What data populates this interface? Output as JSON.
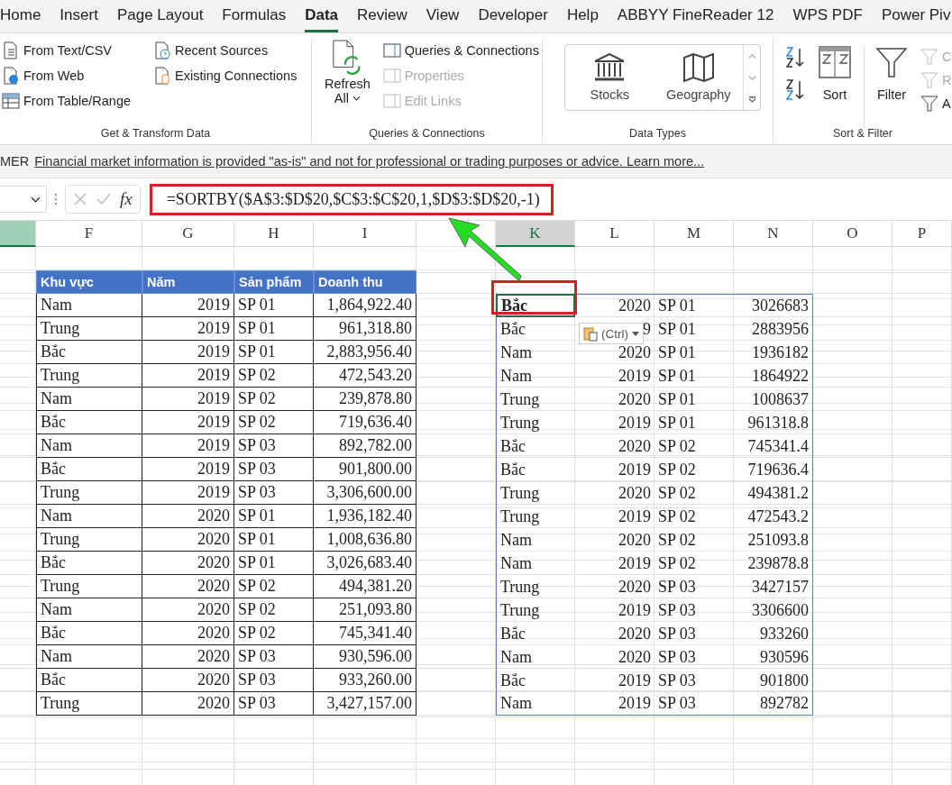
{
  "ribbon_tabs": [
    {
      "label": "Home",
      "selected": false
    },
    {
      "label": "Insert",
      "selected": false
    },
    {
      "label": "Page Layout",
      "selected": false
    },
    {
      "label": "Formulas",
      "selected": false
    },
    {
      "label": "Data",
      "selected": true
    },
    {
      "label": "Review",
      "selected": false
    },
    {
      "label": "View",
      "selected": false
    },
    {
      "label": "Developer",
      "selected": false
    },
    {
      "label": "Help",
      "selected": false
    },
    {
      "label": "ABBYY FineReader 12",
      "selected": false
    },
    {
      "label": "WPS PDF",
      "selected": false
    },
    {
      "label": "Power Piv",
      "selected": false
    }
  ],
  "get_transform": {
    "label": "Get & Transform Data",
    "col1": [
      {
        "label": "From Text/CSV",
        "kind": "text"
      },
      {
        "label": "From Web",
        "kind": "web"
      },
      {
        "label": "From Table/Range",
        "kind": "table"
      }
    ],
    "col2": [
      {
        "label": "Recent Sources",
        "kind": "recent"
      },
      {
        "label": "Existing Connections",
        "kind": "existing"
      }
    ]
  },
  "queries": {
    "label": "Queries & Connections",
    "refresh": {
      "line1": "Refresh",
      "line2": "All"
    },
    "items": [
      {
        "label": "Queries & Connections",
        "disabled": false
      },
      {
        "label": "Properties",
        "disabled": true
      },
      {
        "label": "Edit Links",
        "disabled": true
      }
    ]
  },
  "data_types": {
    "label": "Data Types",
    "items": [
      {
        "label": "Stocks",
        "kind": "stocks"
      },
      {
        "label": "Geography",
        "kind": "geography"
      }
    ]
  },
  "sort_filter": {
    "label": "Sort & Filter",
    "sort": "Sort",
    "filter": "Filter",
    "side": [
      {
        "label": "C",
        "disabled": true
      },
      {
        "label": "R",
        "disabled": true
      },
      {
        "label": "A",
        "disabled": false
      }
    ]
  },
  "message_bar": {
    "label": "MER",
    "link": "Financial market information is provided \"as-is\" and not for professional or trading purposes or advice. Learn more..."
  },
  "formula_bar": {
    "fx": "fx",
    "formula": "=SORTBY($A$3:$D$20,$C$3:$C$20,1,$D$3:$D$20,-1)"
  },
  "columns": [
    {
      "selected": true
    },
    {
      "label": "F",
      "selected": false
    },
    {
      "label": "G",
      "selected": false
    },
    {
      "label": "H",
      "selected": false
    },
    {
      "label": "I",
      "selected": false
    },
    {
      "label": "K",
      "selected": true
    },
    {
      "label": "L",
      "selected": false
    },
    {
      "label": "M",
      "selected": false
    },
    {
      "label": "N",
      "selected": false
    },
    {
      "label": "O",
      "selected": false
    },
    {
      "label": "P",
      "selected": false
    }
  ],
  "source_table": {
    "headers": [
      "Khu vực",
      "Năm",
      "Sản phẩm",
      "Doanh thu"
    ],
    "rows": [
      [
        "Nam",
        "2019",
        "SP 01",
        "1,864,922.40"
      ],
      [
        "Trung",
        "2019",
        "SP 01",
        "961,318.80"
      ],
      [
        "Bắc",
        "2019",
        "SP 01",
        "2,883,956.40"
      ],
      [
        "Trung",
        "2019",
        "SP 02",
        "472,543.20"
      ],
      [
        "Nam",
        "2019",
        "SP 02",
        "239,878.80"
      ],
      [
        "Bắc",
        "2019",
        "SP 02",
        "719,636.40"
      ],
      [
        "Nam",
        "2019",
        "SP 03",
        "892,782.00"
      ],
      [
        "Bắc",
        "2019",
        "SP 03",
        "901,800.00"
      ],
      [
        "Trung",
        "2019",
        "SP 03",
        "3,306,600.00"
      ],
      [
        "Nam",
        "2020",
        "SP 01",
        "1,936,182.40"
      ],
      [
        "Trung",
        "2020",
        "SP 01",
        "1,008,636.80"
      ],
      [
        "Bắc",
        "2020",
        "SP 01",
        "3,026,683.40"
      ],
      [
        "Trung",
        "2020",
        "SP 02",
        "494,381.20"
      ],
      [
        "Nam",
        "2020",
        "SP 02",
        "251,093.80"
      ],
      [
        "Bắc",
        "2020",
        "SP 02",
        "745,341.40"
      ],
      [
        "Nam",
        "2020",
        "SP 03",
        "930,596.00"
      ],
      [
        "Bắc",
        "2020",
        "SP 03",
        "933,260.00"
      ],
      [
        "Trung",
        "2020",
        "SP 03",
        "3,427,157.00"
      ]
    ]
  },
  "sorted_table": {
    "rows": [
      [
        "Bắc",
        "2020",
        "SP 01",
        "3026683"
      ],
      [
        "Bắc",
        "9",
        "SP 01",
        "2883956"
      ],
      [
        "Nam",
        "2020",
        "SP 01",
        "1936182"
      ],
      [
        "Nam",
        "2019",
        "SP 01",
        "1864922"
      ],
      [
        "Trung",
        "2020",
        "SP 01",
        "1008637"
      ],
      [
        "Trung",
        "2019",
        "SP 01",
        "961318.8"
      ],
      [
        "Bắc",
        "2020",
        "SP 02",
        "745341.4"
      ],
      [
        "Bắc",
        "2019",
        "SP 02",
        "719636.4"
      ],
      [
        "Trung",
        "2020",
        "SP 02",
        "494381.2"
      ],
      [
        "Trung",
        "2019",
        "SP 02",
        "472543.2"
      ],
      [
        "Nam",
        "2020",
        "SP 02",
        "251093.8"
      ],
      [
        "Nam",
        "2019",
        "SP 02",
        "239878.8"
      ],
      [
        "Trung",
        "2020",
        "SP 03",
        "3427157"
      ],
      [
        "Trung",
        "2019",
        "SP 03",
        "3306600"
      ],
      [
        "Bắc",
        "2020",
        "SP 03",
        "933260"
      ],
      [
        "Nam",
        "2020",
        "SP 03",
        "930596"
      ],
      [
        "Bắc",
        "2019",
        "SP 03",
        "901800"
      ],
      [
        "Nam",
        "2019",
        "SP 03",
        "892782"
      ]
    ]
  },
  "paste_options": {
    "label": "(Ctrl)"
  }
}
